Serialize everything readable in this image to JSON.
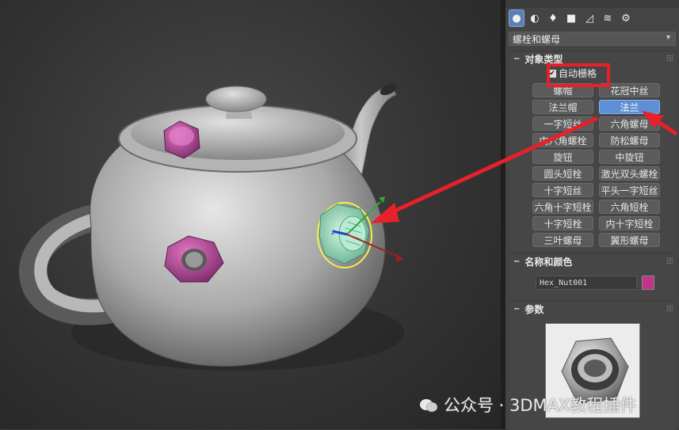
{
  "panel": {
    "tabs": [
      {
        "icon": "geometry-icon",
        "glyph": "●",
        "active": true
      },
      {
        "icon": "shapes-icon",
        "glyph": "◐",
        "active": false
      },
      {
        "icon": "lights-icon",
        "glyph": "♦",
        "active": false
      },
      {
        "icon": "cameras-icon",
        "glyph": "■",
        "active": false
      },
      {
        "icon": "helpers-icon",
        "glyph": "◿",
        "active": false
      },
      {
        "icon": "spacewarps-icon",
        "glyph": "≋",
        "active": false
      },
      {
        "icon": "systems-icon",
        "glyph": "⚙",
        "active": false
      }
    ],
    "category_dropdown": "螺栓和螺母",
    "object_type": {
      "title": "对象类型",
      "autogrid_label": "自动栅格",
      "buttons": [
        "螺帽",
        "花冠中丝",
        "法兰帽",
        "法兰",
        "一字短丝",
        "六角螺母",
        "内六角螺栓",
        "防松螺母",
        "旋钮",
        "中旋钮",
        "圆头短栓",
        "激光双头螺栓",
        "十字短丝",
        "平头一字短丝",
        "六角十字短栓",
        "六角短栓",
        "十字短栓",
        "内十字短栓",
        "三叶螺母",
        "翼形螺母"
      ],
      "active_button": "法兰"
    },
    "name_color": {
      "title": "名称和颜色",
      "name_value": "Hex_Nut001",
      "color": "#c2348a"
    },
    "params": {
      "title": "参数"
    }
  },
  "watermark": "公众号 · 3DMAX教程插件",
  "colors": {
    "annotation": "#e8202a",
    "selection": "#f2f24a",
    "nut_magenta": "#c2348a",
    "nut_green": "#9ee0c0"
  }
}
